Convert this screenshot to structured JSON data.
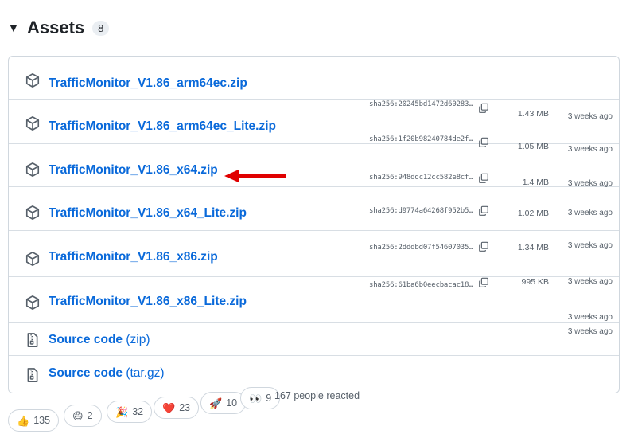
{
  "header": {
    "title": "Assets",
    "count": "8"
  },
  "assets": [
    {
      "name": "TrafficMonitor_V1.86_arm64ec.zip",
      "sha": "sha256:20245bd1472d60283…",
      "size": "1.43 MB",
      "date": "3 weeks ago"
    },
    {
      "name": "TrafficMonitor_V1.86_arm64ec_Lite.zip",
      "sha": "sha256:1f20b98240784de2f…",
      "size": "1.05 MB",
      "date": "3 weeks ago"
    },
    {
      "name": "TrafficMonitor_V1.86_x64.zip",
      "sha": "sha256:948ddc12cc582e8cf…",
      "size": "1.4 MB",
      "date": "3 weeks ago"
    },
    {
      "name": "TrafficMonitor_V1.86_x64_Lite.zip",
      "sha": "sha256:d9774a64268f952b5…",
      "size": "1.02 MB",
      "date": "3 weeks ago"
    },
    {
      "name": "TrafficMonitor_V1.86_x86.zip",
      "sha": "sha256:2dddbd07f54607035…",
      "size": "1.34 MB",
      "date": "3 weeks ago"
    },
    {
      "name": "TrafficMonitor_V1.86_x86_Lite.zip",
      "sha": "sha256:61ba6b0eecbacac18…",
      "size": "995 KB",
      "date": "3 weeks ago"
    }
  ],
  "source": [
    {
      "label": "Source code",
      "format": "(zip)",
      "date": "3 weeks ago"
    },
    {
      "label": "Source code",
      "format": "(tar.gz)",
      "date": "3 weeks ago"
    }
  ],
  "reactions": {
    "items": [
      {
        "emoji": "👍",
        "count": "135"
      },
      {
        "emoji": "😄",
        "count": "2"
      },
      {
        "emoji": "🎉",
        "count": "32"
      },
      {
        "emoji": "❤️",
        "count": "23"
      },
      {
        "emoji": "🚀",
        "count": "10"
      },
      {
        "emoji": "👀",
        "count": "9"
      }
    ],
    "summary": "167 people reacted"
  },
  "colors": {
    "link": "#0969da",
    "muted": "#57606a",
    "arrow": "#e00000",
    "border": "#d0d7de"
  }
}
